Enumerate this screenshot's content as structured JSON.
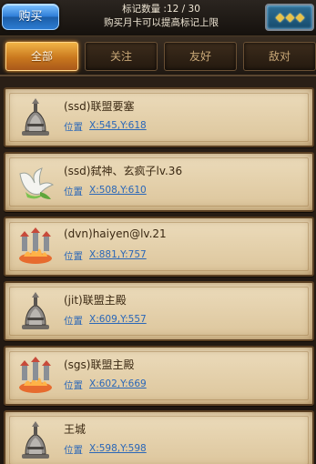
{
  "header": {
    "buy_button": "购买",
    "mark_count": "标记数量 :12 / 30",
    "hint": "购买月卡可以提高标记上限",
    "more_icon": "more-icon"
  },
  "tabs": [
    {
      "label": "全部",
      "active": true
    },
    {
      "label": "关注",
      "active": false
    },
    {
      "label": "友好",
      "active": false
    },
    {
      "label": "敌对",
      "active": false
    }
  ],
  "list": {
    "pos_label": "位置",
    "items": [
      {
        "name": "(ssd)联盟要塞",
        "coord": "X:545,Y:618",
        "icon": "bell-tower-icon"
      },
      {
        "name": "(ssd)弑神、玄疯子lv.36",
        "coord": "X:508,Y:610",
        "icon": "white-bird-icon"
      },
      {
        "name": "(dvn)haiyen@lv.21",
        "coord": "X:881,Y:757",
        "icon": "burning-camp-icon"
      },
      {
        "name": "(jit)联盟主殿",
        "coord": "X:609,Y:557",
        "icon": "bell-tower-icon"
      },
      {
        "name": "(sgs)联盟主殿",
        "coord": "X:602,Y:669",
        "icon": "burning-camp-icon"
      },
      {
        "name": "王城",
        "coord": "X:598,Y:598",
        "icon": "bell-tower-icon"
      }
    ]
  }
}
